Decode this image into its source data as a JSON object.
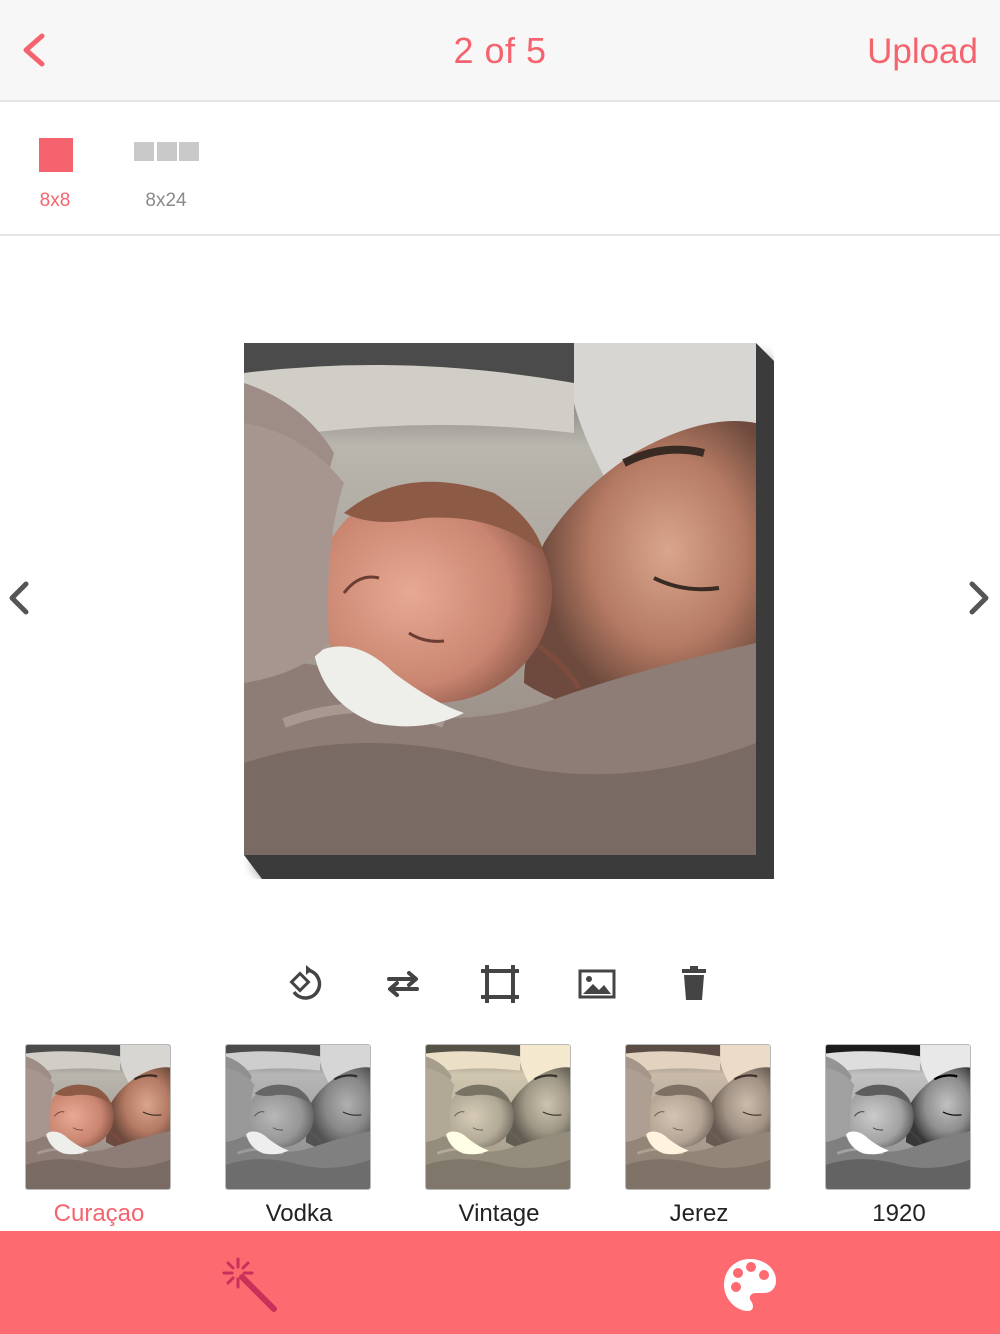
{
  "nav": {
    "title": "2 of 5",
    "upload_label": "Upload"
  },
  "sizes": [
    {
      "label": "8x8",
      "selected": true
    },
    {
      "label": "8x24",
      "selected": false
    }
  ],
  "tools": [
    "rotate-icon",
    "flip-icon",
    "crop-icon",
    "image-icon",
    "trash-icon"
  ],
  "filters": [
    {
      "name": "Curaçao",
      "selected": true
    },
    {
      "name": "Vodka",
      "selected": false
    },
    {
      "name": "Vintage",
      "selected": false
    },
    {
      "name": "Jerez",
      "selected": false
    },
    {
      "name": "1920",
      "selected": false
    }
  ],
  "tabs": [
    "magic-wand-icon",
    "palette-icon"
  ],
  "colors": {
    "accent": "#f5646e",
    "tabbar": "#fd6a70",
    "canvas_edge": "#3a3a3a"
  }
}
